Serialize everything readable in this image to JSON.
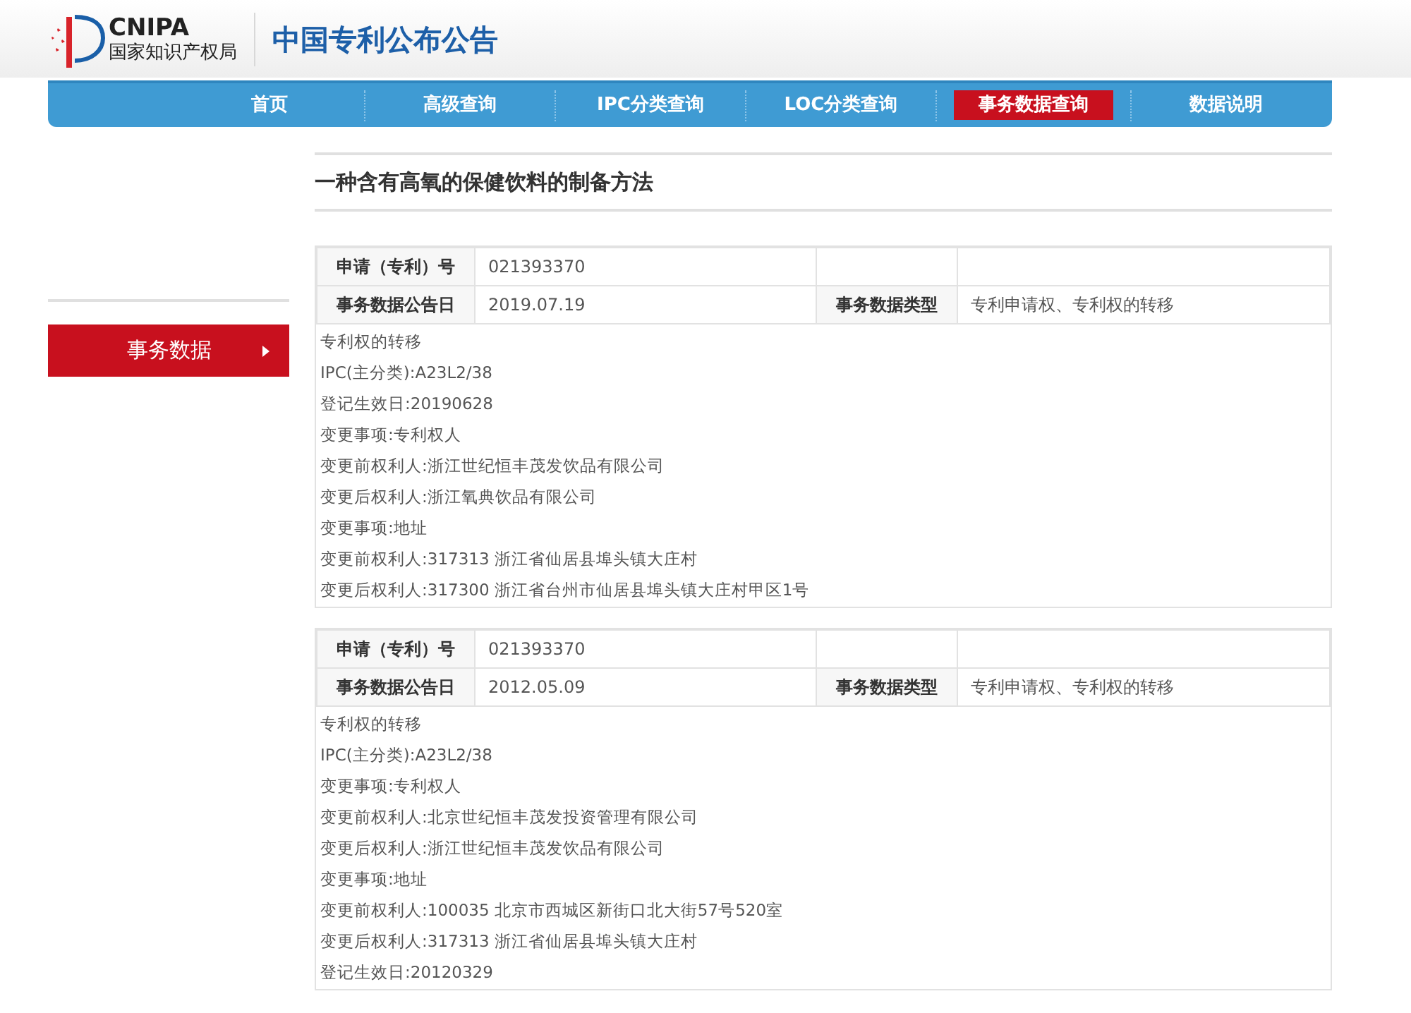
{
  "header": {
    "logo_abbr": "CNIPA",
    "logo_org": "国家知识产权局",
    "site_title": "中国专利公布公告"
  },
  "nav": [
    {
      "label": "首页",
      "selected": false
    },
    {
      "label": "高级查询",
      "selected": false
    },
    {
      "label": "IPC分类查询",
      "selected": false
    },
    {
      "label": "LOC分类查询",
      "selected": false
    },
    {
      "label": "事务数据查询",
      "selected": true
    },
    {
      "label": "数据说明",
      "selected": false
    }
  ],
  "sidebar": {
    "items": [
      {
        "label": "事务数据",
        "selected": true
      }
    ]
  },
  "page_title": "一种含有高氧的保健饮料的制备方法",
  "records": [
    {
      "app_no_label": "申请（专利）号",
      "app_no": "021393370",
      "date_label": "事务数据公告日",
      "date": "2019.07.19",
      "type_label": "事务数据类型",
      "type": "专利申请权、专利权的转移",
      "details": [
        "专利权的转移",
        "IPC(主分类):A23L2/38",
        "登记生效日:20190628",
        "变更事项:专利权人",
        "变更前权利人:浙江世纪恒丰茂发饮品有限公司",
        "变更后权利人:浙江氧典饮品有限公司",
        "变更事项:地址",
        "变更前权利人:317313 浙江省仙居县埠头镇大庄村",
        "变更后权利人:317300 浙江省台州市仙居县埠头镇大庄村甲区1号"
      ]
    },
    {
      "app_no_label": "申请（专利）号",
      "app_no": "021393370",
      "date_label": "事务数据公告日",
      "date": "2012.05.09",
      "type_label": "事务数据类型",
      "type": "专利申请权、专利权的转移",
      "details": [
        "专利权的转移",
        "IPC(主分类):A23L2/38",
        "变更事项:专利权人",
        "变更前权利人:北京世纪恒丰茂发投资管理有限公司",
        "变更后权利人:浙江世纪恒丰茂发饮品有限公司",
        "变更事项:地址",
        "变更前权利人:100035 北京市西城区新街口北大街57号520室",
        "变更后权利人:317313 浙江省仙居县埠头镇大庄村",
        "登记生效日:20120329"
      ]
    }
  ]
}
